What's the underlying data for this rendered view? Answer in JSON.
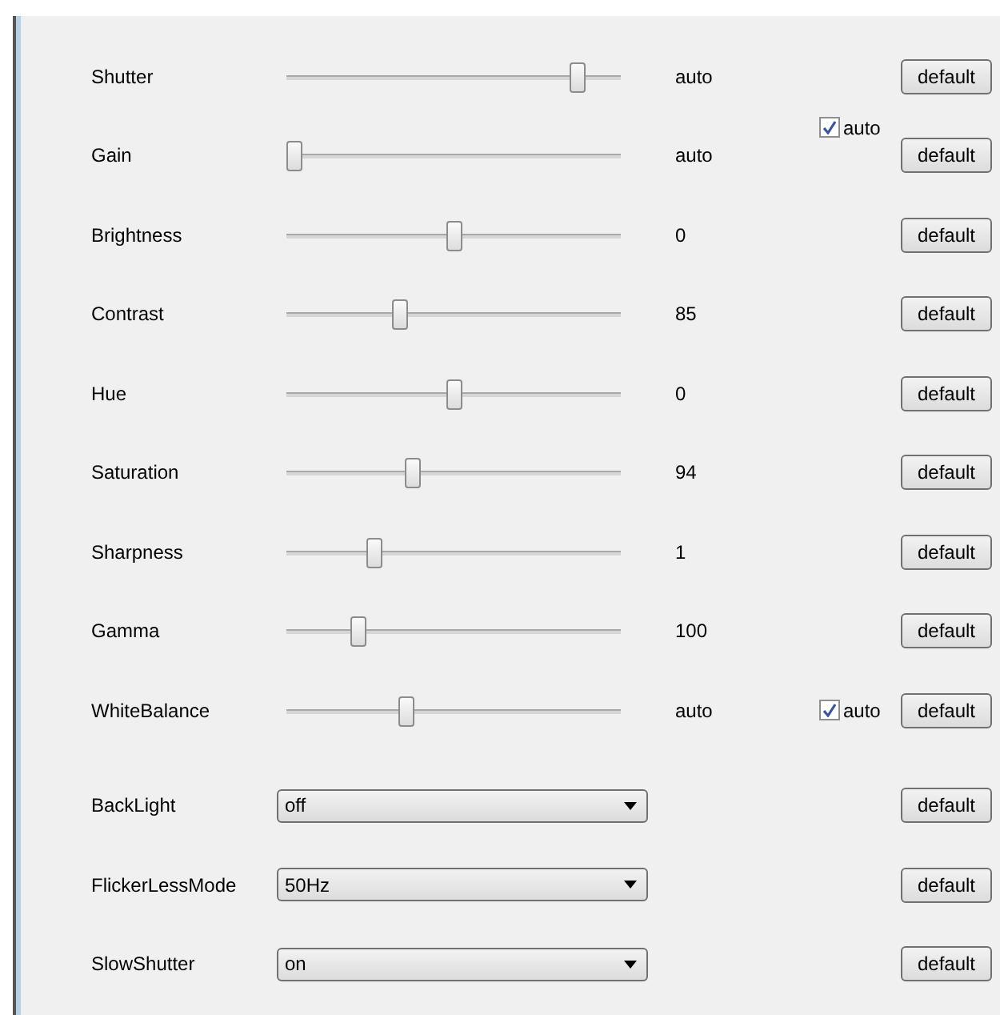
{
  "controls": [
    {
      "kind": "slider",
      "label": "Shutter",
      "level": 0.89,
      "reading": "auto",
      "button": "default"
    },
    {
      "kind": "checkbox",
      "label": "auto",
      "checked": true
    },
    {
      "kind": "slider",
      "label": "Gain",
      "level": 0.0,
      "reading": "auto",
      "button": "default"
    },
    {
      "kind": "slider",
      "label": "Brightness",
      "level": 0.5,
      "reading": "0",
      "button": "default"
    },
    {
      "kind": "slider",
      "label": "Contrast",
      "level": 0.33,
      "reading": "85",
      "button": "default"
    },
    {
      "kind": "slider",
      "label": "Hue",
      "level": 0.5,
      "reading": "0",
      "button": "default"
    },
    {
      "kind": "slider",
      "label": "Saturation",
      "level": 0.37,
      "reading": "94",
      "button": "default"
    },
    {
      "kind": "slider",
      "label": "Sharpness",
      "level": 0.25,
      "reading": "1",
      "button": "default"
    },
    {
      "kind": "slider",
      "label": "Gamma",
      "level": 0.2,
      "reading": "100",
      "button": "default"
    },
    {
      "kind": "slider",
      "label": "WhiteBalance",
      "level": 0.35,
      "reading": "auto",
      "auto": {
        "label": "auto",
        "checked": true
      },
      "button": "default"
    },
    {
      "kind": "dropdown",
      "label": "BackLight",
      "value": "off",
      "button": "default"
    },
    {
      "kind": "dropdown",
      "label": "FlickerLessMode",
      "value": "50Hz",
      "button": "default"
    },
    {
      "kind": "dropdown",
      "label": "SlowShutter",
      "value": "on",
      "button": "default"
    }
  ]
}
